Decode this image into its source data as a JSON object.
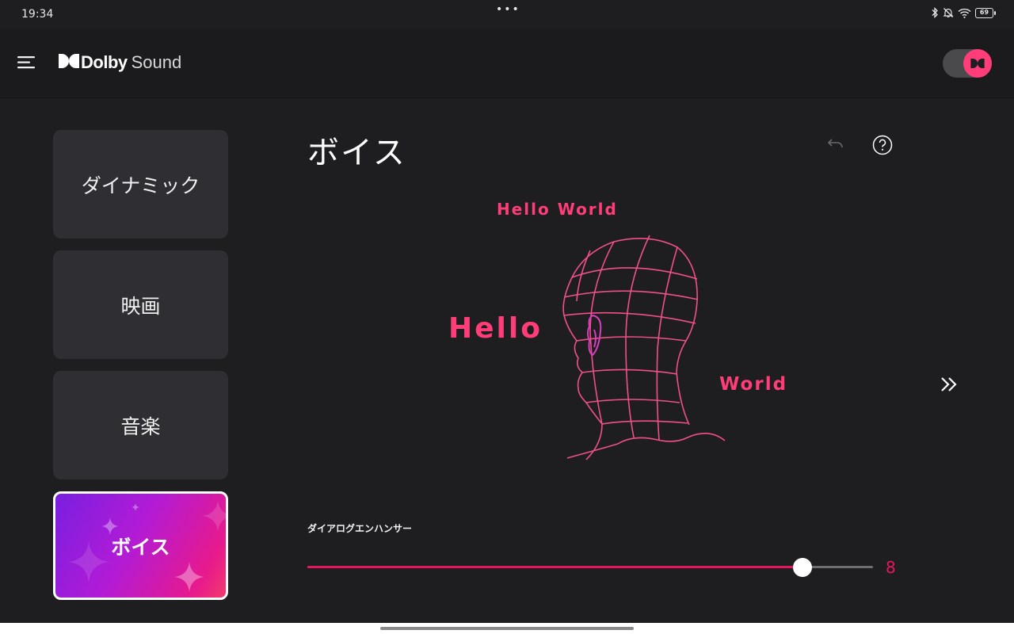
{
  "status": {
    "time": "19:34",
    "dots": "•••",
    "battery": "69",
    "icons": [
      "bluetooth-icon",
      "bell-off-icon",
      "wifi-icon",
      "battery-icon"
    ]
  },
  "app": {
    "logo_bold": "Dolby",
    "logo_light": "Sound",
    "toggle_on": true,
    "accent": "#ff3d78"
  },
  "sidebar": {
    "items": [
      {
        "label": "ダイナミック",
        "active": false
      },
      {
        "label": "映画",
        "active": false
      },
      {
        "label": "音楽",
        "active": false
      },
      {
        "label": "ボイス",
        "active": true
      }
    ]
  },
  "main": {
    "title": "ボイス",
    "illustration": {
      "text_top": "Hello World",
      "text_left": "Hello",
      "text_right": "World"
    },
    "slider": {
      "label": "ダイアログエンハンサー",
      "value": "8",
      "fraction": 0.875,
      "fill_color": "#e8175d"
    }
  }
}
